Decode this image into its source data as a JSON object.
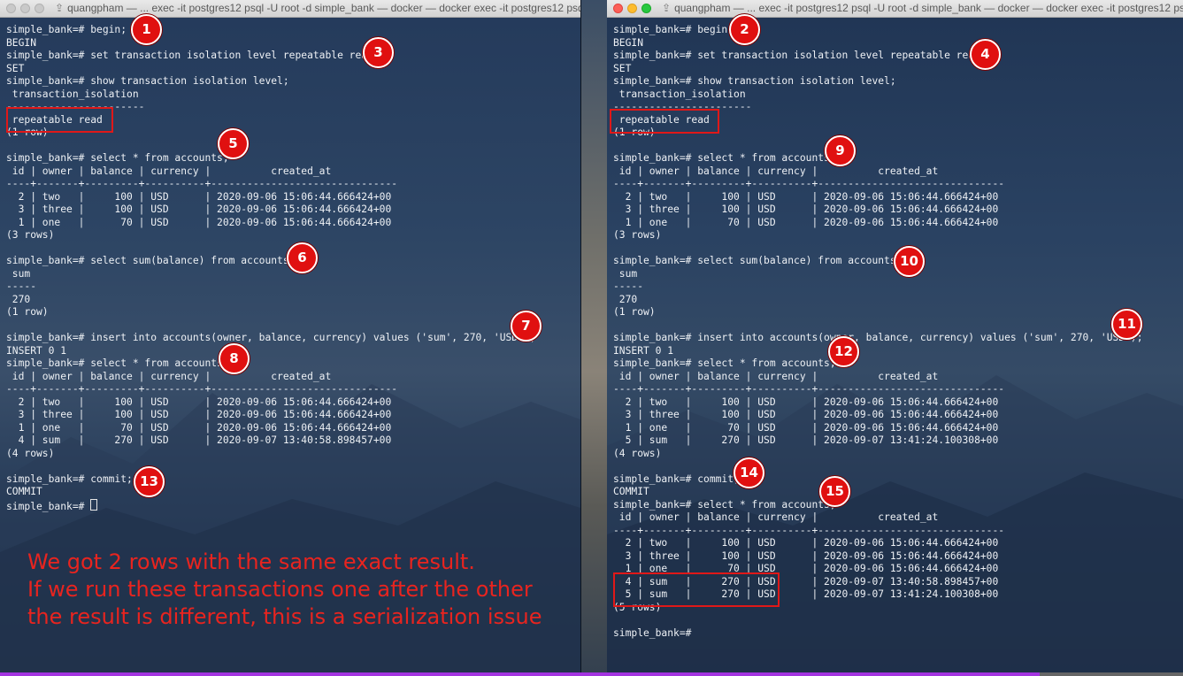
{
  "colors": {
    "badge": "#e01010",
    "highlight": "#e01818",
    "note_text": "#e8241f",
    "terminal_text": "#eef1f5"
  },
  "left_terminal": {
    "title": "quangpham — ... exec -it postgres12 psql -U root -d simple_bank — docker — docker exec -it postgres12 psql -U r...",
    "lines": [
      "simple_bank=# begin;",
      "BEGIN",
      "simple_bank=# set transaction isolation level repeatable read;",
      "SET",
      "simple_bank=# show transaction isolation level;",
      " transaction_isolation",
      "-----------------------",
      " repeatable read",
      "(1 row)",
      "",
      "simple_bank=# select * from accounts;",
      " id | owner | balance | currency |          created_at",
      "----+-------+---------+----------+-------------------------------",
      "  2 | two   |     100 | USD      | 2020-09-06 15:06:44.666424+00",
      "  3 | three |     100 | USD      | 2020-09-06 15:06:44.666424+00",
      "  1 | one   |      70 | USD      | 2020-09-06 15:06:44.666424+00",
      "(3 rows)",
      "",
      "simple_bank=# select sum(balance) from accounts;",
      " sum",
      "-----",
      " 270",
      "(1 row)",
      "",
      "simple_bank=# insert into accounts(owner, balance, currency) values ('sum', 270, 'USD');",
      "INSERT 0 1",
      "simple_bank=# select * from accounts;",
      " id | owner | balance | currency |          created_at",
      "----+-------+---------+----------+-------------------------------",
      "  2 | two   |     100 | USD      | 2020-09-06 15:06:44.666424+00",
      "  3 | three |     100 | USD      | 2020-09-06 15:06:44.666424+00",
      "  1 | one   |      70 | USD      | 2020-09-06 15:06:44.666424+00",
      "  4 | sum   |     270 | USD      | 2020-09-07 13:40:58.898457+00",
      "(4 rows)",
      "",
      "simple_bank=# commit;",
      "COMMIT",
      "simple_bank=# "
    ]
  },
  "right_terminal": {
    "title": "quangpham — ... exec -it postgres12 psql -U root -d simple_bank — docker — docker exec -it postgres12 psql -U r...",
    "lines": [
      "simple_bank=# begin;",
      "BEGIN",
      "simple_bank=# set transaction isolation level repeatable read;",
      "SET",
      "simple_bank=# show transaction isolation level;",
      " transaction_isolation",
      "-----------------------",
      " repeatable read",
      "(1 row)",
      "",
      "simple_bank=# select * from accounts;",
      " id | owner | balance | currency |          created_at",
      "----+-------+---------+----------+-------------------------------",
      "  2 | two   |     100 | USD      | 2020-09-06 15:06:44.666424+00",
      "  3 | three |     100 | USD      | 2020-09-06 15:06:44.666424+00",
      "  1 | one   |      70 | USD      | 2020-09-06 15:06:44.666424+00",
      "(3 rows)",
      "",
      "simple_bank=# select sum(balance) from accounts;",
      " sum",
      "-----",
      " 270",
      "(1 row)",
      "",
      "simple_bank=# insert into accounts(owner, balance, currency) values ('sum', 270, 'USD');",
      "INSERT 0 1",
      "simple_bank=# select * from accounts;",
      " id | owner | balance | currency |          created_at",
      "----+-------+---------+----------+-------------------------------",
      "  2 | two   |     100 | USD      | 2020-09-06 15:06:44.666424+00",
      "  3 | three |     100 | USD      | 2020-09-06 15:06:44.666424+00",
      "  1 | one   |      70 | USD      | 2020-09-06 15:06:44.666424+00",
      "  5 | sum   |     270 | USD      | 2020-09-07 13:41:24.100308+00",
      "(4 rows)",
      "",
      "simple_bank=# commit;",
      "COMMIT",
      "simple_bank=# select * from accounts;",
      " id | owner | balance | currency |          created_at",
      "----+-------+---------+----------+-------------------------------",
      "  2 | two   |     100 | USD      | 2020-09-06 15:06:44.666424+00",
      "  3 | three |     100 | USD      | 2020-09-06 15:06:44.666424+00",
      "  1 | one   |      70 | USD      | 2020-09-06 15:06:44.666424+00",
      "  4 | sum   |     270 | USD      | 2020-09-07 13:40:58.898457+00",
      "  5 | sum   |     270 | USD      | 2020-09-07 13:41:24.100308+00",
      "(5 rows)",
      "",
      "simple_bank=#"
    ]
  },
  "step_badges": [
    "1",
    "2",
    "3",
    "4",
    "5",
    "6",
    "7",
    "8",
    "9",
    "10",
    "11",
    "12",
    "13",
    "14",
    "15"
  ],
  "annotation": {
    "line1": "We got 2 rows with the same exact result.",
    "line2": "If we run these transactions one after the other",
    "line3": "the result is different, this is a serialization issue"
  }
}
